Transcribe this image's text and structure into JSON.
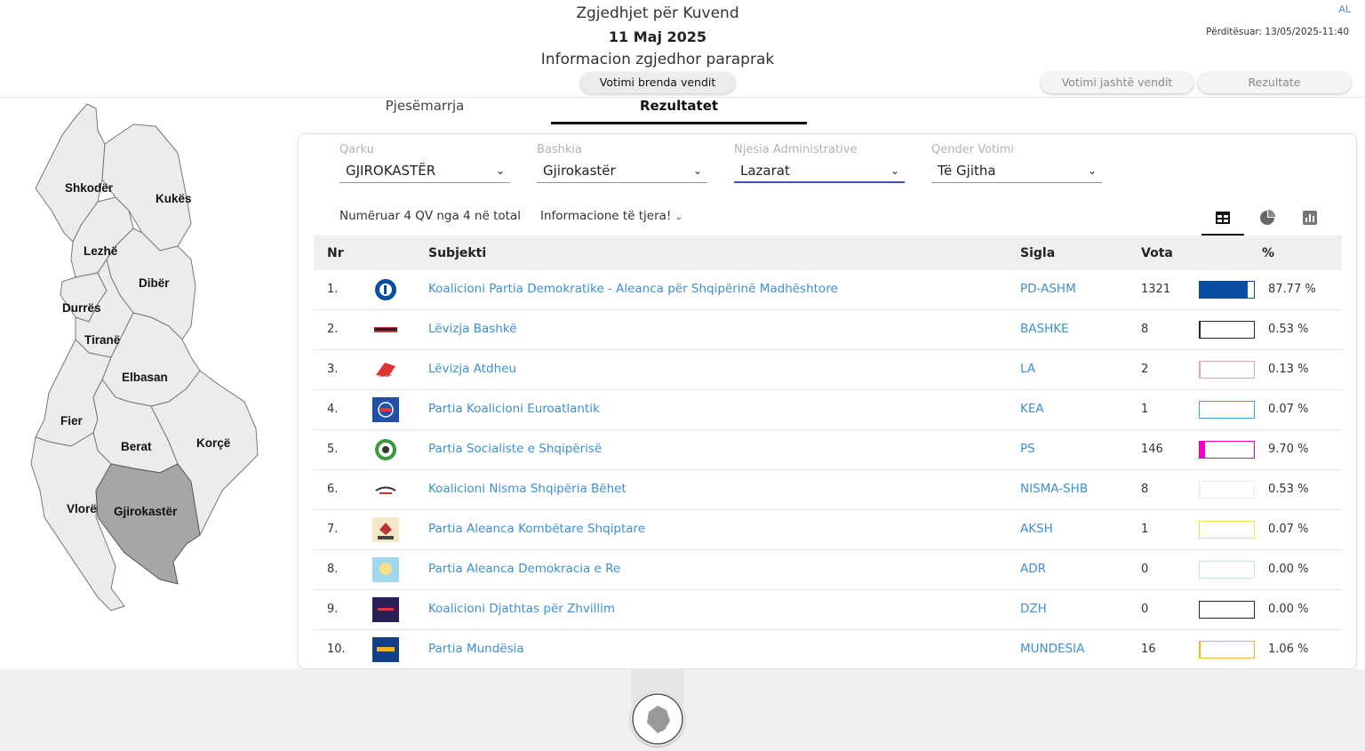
{
  "header": {
    "title": "Zgjedhjet për Kuvend",
    "date": "11 Maj 2025",
    "subtitle": "Informacion zgjedhor paraprak",
    "lang": "AL",
    "updated": "Përditësuar: 13/05/2025-11:40",
    "btn_inside": "Votimi brenda vendit",
    "btn_outside": "Votimi jashtë vendit",
    "btn_results": "Rezultate"
  },
  "tabs": {
    "participation": "Pjesëmarrja",
    "results": "Rezultatet",
    "active": "results"
  },
  "map": {
    "selected": "Gjirokastër",
    "regions": [
      "Shkodër",
      "Kukës",
      "Lezhë",
      "Dibër",
      "Durrës",
      "Tiranë",
      "Elbasan",
      "Fier",
      "Berat",
      "Korçë",
      "Vlorë",
      "Gjirokastër"
    ]
  },
  "filters": {
    "qarku": {
      "label": "Qarku",
      "value": "GJIROKASTËR"
    },
    "bashkia": {
      "label": "Bashkia",
      "value": "Gjirokastër"
    },
    "njesia": {
      "label": "Njesia Administrative",
      "value": "Lazarat"
    },
    "qender": {
      "label": "Qender Votimi",
      "value": "Të Gjitha"
    }
  },
  "counted": "Numëruar 4 QV nga 4 në total",
  "more_info": "Informacione të tjera!",
  "view_icons": [
    "table-icon",
    "pie-chart-icon",
    "bar-chart-icon"
  ],
  "table": {
    "headers": {
      "nr": "Nr",
      "subject": "Subjekti",
      "sigla": "Sigla",
      "votes": "Vota",
      "pct": "%"
    },
    "rows": [
      {
        "nr": "1.",
        "name": "Koalicioni Partia Demokratike - Aleanca për Shqipërinë Madhështore",
        "sigla": "PD-ASHM",
        "votes": "1321",
        "pct": "87.77 %",
        "share": 0.8777,
        "color": "#0a4ea3",
        "border": "#0a4ea3",
        "logo": "pd-logo"
      },
      {
        "nr": "2.",
        "name": "Lëvizja Bashkë",
        "sigla": "BASHKE",
        "votes": "8",
        "pct": "0.53 %",
        "share": 0.0053,
        "color": "#222222",
        "border": "#222222",
        "logo": "bashke-logo"
      },
      {
        "nr": "3.",
        "name": "Lëvizja Atdheu",
        "sigla": "LA",
        "votes": "2",
        "pct": "0.13 %",
        "share": 0.0013,
        "color": "#e8a8a8",
        "border": "#e8a8a8",
        "logo": "atdheu-logo"
      },
      {
        "nr": "4.",
        "name": "Partia Koalicioni Euroatlantik",
        "sigla": "KEA",
        "votes": "1",
        "pct": "0.07 %",
        "share": 0.0007,
        "color": "#3aa0e0",
        "border": "#3aa0e0",
        "logo": "kea-logo"
      },
      {
        "nr": "5.",
        "name": "Partia Socialiste e Shqipërisë",
        "sigla": "PS",
        "votes": "146",
        "pct": "9.70 %",
        "share": 0.097,
        "color": "#ee00cc",
        "border": "#ee00cc",
        "logo": "ps-logo"
      },
      {
        "nr": "6.",
        "name": "Koalicioni Nisma Shqipëria Bëhet",
        "sigla": "NISMA-SHB",
        "votes": "8",
        "pct": "0.53 %",
        "share": 0.0053,
        "color": "#f4f1e0",
        "border": "#efeede",
        "logo": "nisma-logo"
      },
      {
        "nr": "7.",
        "name": "Partia Aleanca Kombëtare Shqiptare",
        "sigla": "AKSH",
        "votes": "1",
        "pct": "0.07 %",
        "share": 0.0007,
        "color": "#f2e14a",
        "border": "#f2e14a",
        "logo": "aksh-logo"
      },
      {
        "nr": "8.",
        "name": "Partia Aleanca Demokracia e Re",
        "sigla": "ADR",
        "votes": "0",
        "pct": "0.00 %",
        "share": 0,
        "color": "#bfe6f5",
        "border": "#bfe6f5",
        "logo": "adr-logo"
      },
      {
        "nr": "9.",
        "name": "Koalicioni Djathtas për Zhvillim",
        "sigla": "DZH",
        "votes": "0",
        "pct": "0.00 %",
        "share": 0,
        "color": "#222222",
        "border": "#222222",
        "logo": "dzh-logo"
      },
      {
        "nr": "10.",
        "name": "Partia Mundësia",
        "sigla": "MUNDESIA",
        "votes": "16",
        "pct": "1.06 %",
        "share": 0.0106,
        "color": "#f0b030",
        "border": "#f0b030",
        "logo": "mundesia-logo"
      }
    ]
  }
}
